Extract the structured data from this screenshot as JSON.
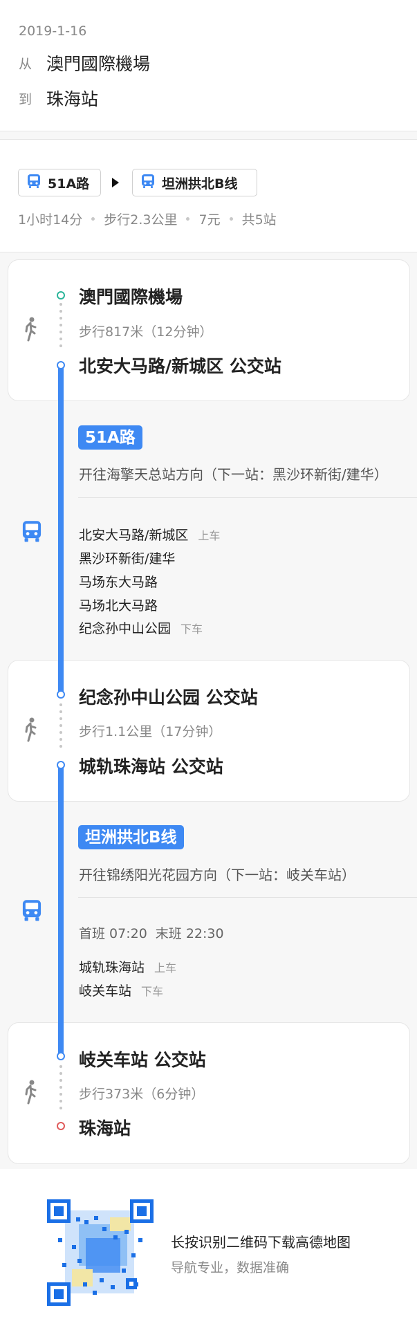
{
  "header": {
    "date": "2019-1-16",
    "from_label": "从",
    "from_place": "澳門國際機場",
    "to_label": "到",
    "to_place": "珠海站"
  },
  "summary": {
    "lines": [
      "51A路",
      "坦洲拱北B线"
    ],
    "duration": "1小时14分",
    "walk_distance": "步行2.3公里",
    "fare": "7元",
    "stops": "共5站"
  },
  "segments": {
    "walk1": {
      "from": "澳門國際機場",
      "detail": "步行817米（12分钟）",
      "to": "北安大马路/新城区 公交站"
    },
    "bus1": {
      "line": "51A路",
      "direction": "开往海擎天总站方向（下一站：黑沙环新街/建华）",
      "stations": [
        {
          "name": "北安大马路/新城区",
          "tag": "上车"
        },
        {
          "name": "黑沙环新街/建华",
          "tag": ""
        },
        {
          "name": "马场东大马路",
          "tag": ""
        },
        {
          "name": "马场北大马路",
          "tag": ""
        },
        {
          "name": "纪念孙中山公园",
          "tag": "下车"
        }
      ]
    },
    "walk2": {
      "from": "纪念孙中山公园 公交站",
      "detail": "步行1.1公里（17分钟）",
      "to": "城轨珠海站 公交站"
    },
    "bus2": {
      "line": "坦洲拱北B线",
      "direction": "开往锦绣阳光花园方向（下一站：岐关车站）",
      "first_bus": "首班 07:20",
      "last_bus": "末班 22:30",
      "stations": [
        {
          "name": "城轨珠海站",
          "tag": "上车"
        },
        {
          "name": "岐关车站",
          "tag": "下车"
        }
      ]
    },
    "walk3": {
      "from": "岐关车站 公交站",
      "detail": "步行373米（6分钟）",
      "to": "珠海站"
    }
  },
  "promo": {
    "title": "长按识别二维码下载高德地图",
    "subtitle": "导航专业，数据准确"
  },
  "colors": {
    "accent": "#3e89f3",
    "start_node": "#2bb59a",
    "end_node": "#e05a5a"
  },
  "icons": [
    "bus-icon",
    "walk-icon",
    "qr-code-icon"
  ]
}
